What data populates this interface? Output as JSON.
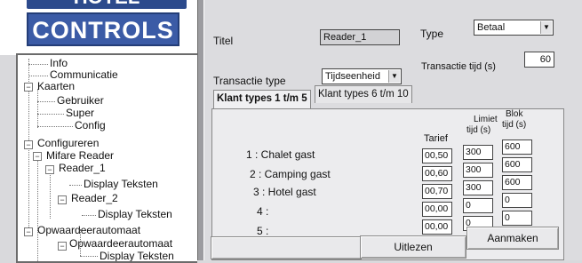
{
  "logo": {
    "top_text": "HOTEL",
    "main_text": "CONTROLS"
  },
  "sidebar": {
    "items": [
      {
        "label": "Info"
      },
      {
        "label": "Communicatie"
      },
      {
        "label": "Kaarten"
      },
      {
        "label": "Gebruiker"
      },
      {
        "label": "Super"
      },
      {
        "label": "Config"
      },
      {
        "label": "Configureren"
      },
      {
        "label": "Mifare Reader"
      },
      {
        "label": "Reader_1"
      },
      {
        "label": "Display Teksten"
      },
      {
        "label": "Reader_2"
      },
      {
        "label": "Display Teksten"
      },
      {
        "label": "Opwaardeerautomaat"
      },
      {
        "label": "Opwaardeerautomaat"
      },
      {
        "label": "Display Teksten"
      }
    ]
  },
  "form": {
    "titel_label": "Titel",
    "titel_value": "Reader_1",
    "type_label": "Type",
    "type_value": "Betaal",
    "transactie_type_label": "Transactie type",
    "transactie_type_value": "Tijdseenheid",
    "transactie_tijd_label": "Transactie tijd (s)",
    "transactie_tijd_value": "60"
  },
  "tabs": [
    {
      "label": "Klant types 1 t/m 5",
      "active": true
    },
    {
      "label": "Klant types 6 t/m 10",
      "active": false
    }
  ],
  "table": {
    "headers": {
      "tarief": "Tarief",
      "limiet_1": "Limiet",
      "limiet_2": "tijd (s)",
      "blok_1": "Blok",
      "blok_2": "tijd (s)"
    },
    "rows": [
      {
        "label": "1 : Chalet gast",
        "tarief": "00,50",
        "limiet": "300",
        "blok": "600"
      },
      {
        "label": "2 : Camping gast",
        "tarief": "00,60",
        "limiet": "300",
        "blok": "600"
      },
      {
        "label": "3 : Hotel gast",
        "tarief": "00,70",
        "limiet": "300",
        "blok": "600"
      },
      {
        "label": "4 :",
        "tarief": "00,00",
        "limiet": "0",
        "blok": "0"
      },
      {
        "label": "5 :",
        "tarief": "00,00",
        "limiet": "0",
        "blok": "0"
      }
    ]
  },
  "buttons": {
    "uitlezen": "Uitlezen",
    "aanmaken": "Aanmaken"
  }
}
